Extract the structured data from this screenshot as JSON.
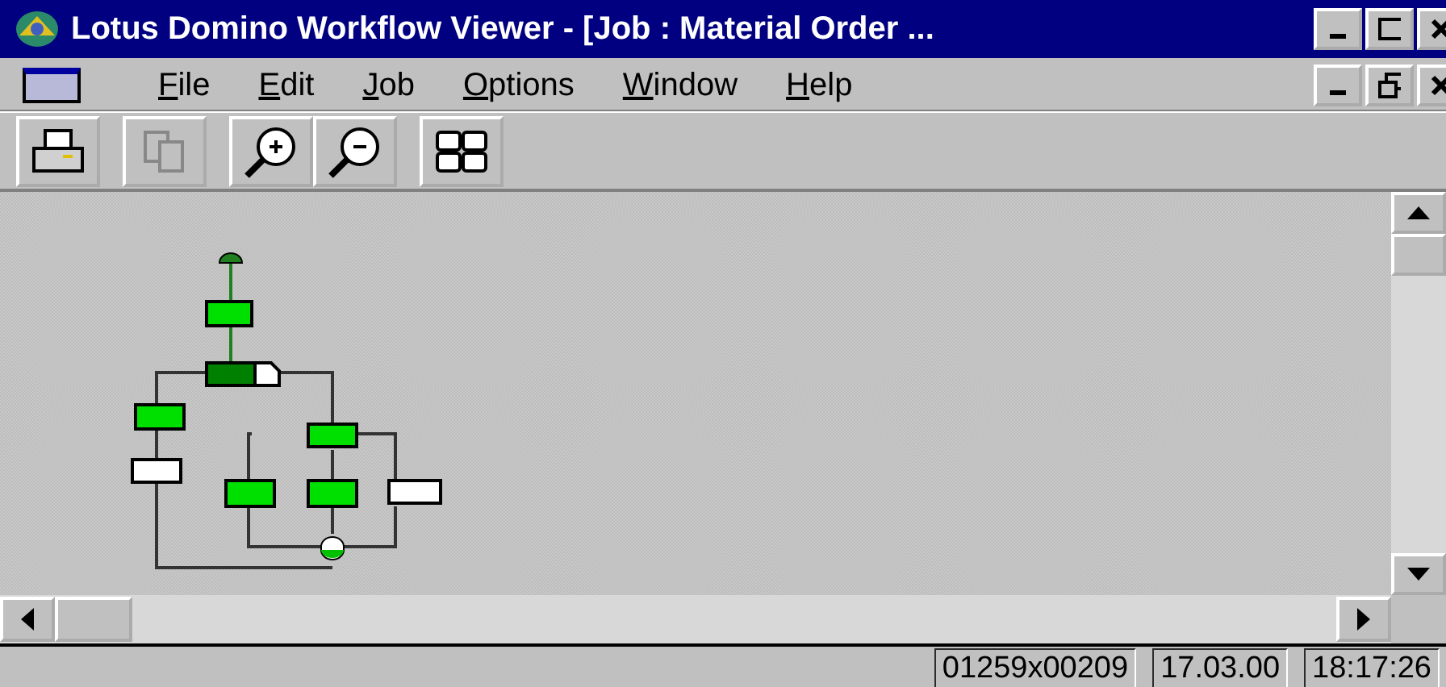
{
  "window": {
    "title": "Lotus Domino Workflow Viewer - [Job : Material Order ..."
  },
  "menu": [
    "File",
    "Edit",
    "Job",
    "Options",
    "Window",
    "Help"
  ],
  "status_bar": [
    "01259x00209",
    "17.03.00",
    "18:17:26"
  ]
}
